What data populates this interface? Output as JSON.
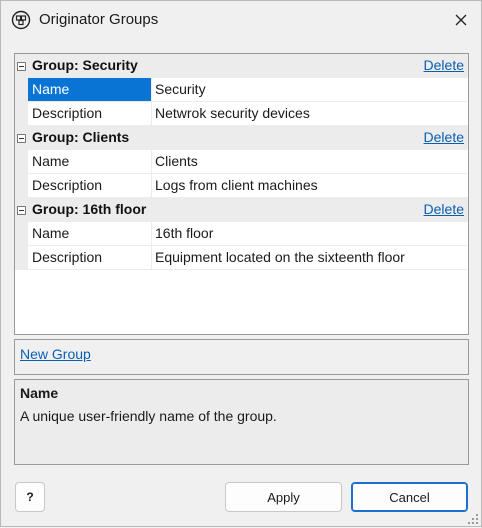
{
  "window": {
    "title": "Originator Groups"
  },
  "groups": [
    {
      "title": "Group: Security",
      "delete_label": "Delete",
      "properties": [
        {
          "name": "Name",
          "value": "Security",
          "selected": true
        },
        {
          "name": "Description",
          "value": "Netwrok security devices",
          "selected": false
        }
      ]
    },
    {
      "title": "Group: Clients",
      "delete_label": "Delete",
      "properties": [
        {
          "name": "Name",
          "value": "Clients",
          "selected": false
        },
        {
          "name": "Description",
          "value": "Logs from client machines",
          "selected": false
        }
      ]
    },
    {
      "title": "Group: 16th floor",
      "delete_label": "Delete",
      "properties": [
        {
          "name": "Name",
          "value": "16th floor",
          "selected": false
        },
        {
          "name": "Description",
          "value": "Equipment located on the sixteenth floor",
          "selected": false
        }
      ]
    }
  ],
  "new_group_label": "New Group",
  "help": {
    "title": "Name",
    "text": "A unique user-friendly name of the group."
  },
  "buttons": {
    "help_label": "?",
    "apply_label": "Apply",
    "cancel_label": "Cancel"
  },
  "colors": {
    "selection": "#0a74d4",
    "link": "#0a5fb0",
    "group_header_bg": "#ececec"
  },
  "icons": {
    "app": "originator-groups-icon",
    "close": "close-icon",
    "collapse": "collapse-minus-icon",
    "grip": "resize-grip-icon"
  }
}
